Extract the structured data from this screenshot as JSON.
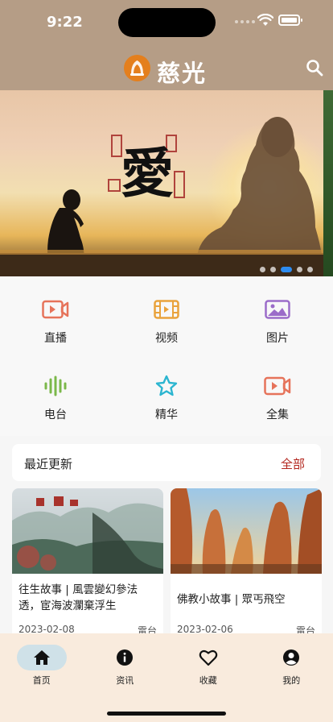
{
  "status": {
    "time": "9:22"
  },
  "header": {
    "title": "慈光",
    "search_icon": "search-icon",
    "logo_icon": "lotus-logo-icon"
  },
  "banner": {
    "calligraphy": "愛",
    "slides": 5,
    "active_slide": 3
  },
  "grid": [
    {
      "label": "直播",
      "icon": "live-video-icon",
      "color": "#e6735a"
    },
    {
      "label": "视频",
      "icon": "film-icon",
      "color": "#e9a23b"
    },
    {
      "label": "图片",
      "icon": "image-icon",
      "color": "#9b6cc9"
    },
    {
      "label": "电台",
      "icon": "audio-wave-icon",
      "color": "#7bb84a"
    },
    {
      "label": "精华",
      "icon": "star-icon",
      "color": "#2bb5d0"
    },
    {
      "label": "全集",
      "icon": "collection-video-icon",
      "color": "#e6735a"
    }
  ],
  "recent": {
    "title": "最近更新",
    "more": "全部"
  },
  "cards": [
    {
      "title": "往生故事 | 風雲變幻參法透，宦海波瀾棄浮生",
      "date": "2023-02-08",
      "tag": "電台"
    },
    {
      "title": "佛教小故事 | 眾丐飛空",
      "date": "2023-02-06",
      "tag": "電台"
    }
  ],
  "tabs": [
    {
      "label": "首页",
      "icon": "home-icon"
    },
    {
      "label": "资讯",
      "icon": "info-icon"
    },
    {
      "label": "收藏",
      "icon": "heart-icon"
    },
    {
      "label": "我的",
      "icon": "user-icon"
    }
  ],
  "colors": {
    "header": "#b59d86",
    "accent": "#b3261e",
    "tabbar": "#f9ebdd",
    "active_tab": "#cfe1e8",
    "logo": "#e47f1d"
  }
}
